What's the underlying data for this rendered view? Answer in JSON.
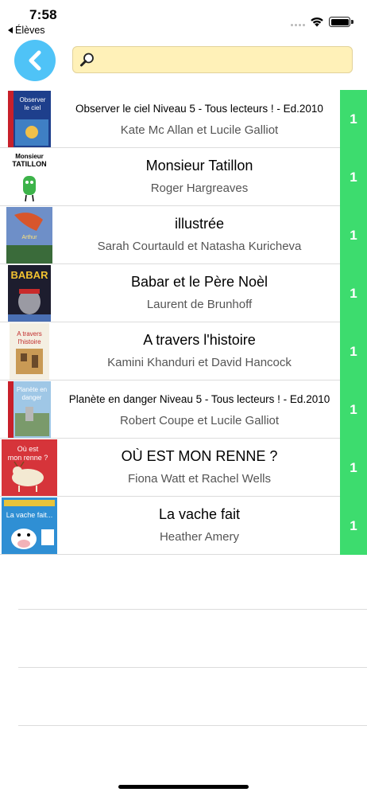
{
  "status": {
    "time": "7:58",
    "back_app_label": "Élèves"
  },
  "nav": {
    "back_icon": "chevron-left-icon",
    "search": {
      "placeholder": "",
      "value": "",
      "icon": "magnifier-icon"
    }
  },
  "colors": {
    "back_button": "#4fc3f7",
    "search_bg": "#fff1b8",
    "count_bg": "#3ddc6e"
  },
  "books": [
    {
      "title": "Observer le ciel Niveau 5 - Tous lecteurs ! - Ed.2010",
      "author": "Kate Mc Allan et Lucile Galliot",
      "count": "1",
      "cover_text": "Observer le ciel"
    },
    {
      "title": "Monsieur Tatillon",
      "author": "Roger Hargreaves",
      "count": "1",
      "cover_text": "Monsieur TATILLON"
    },
    {
      "title": "illustrée",
      "author": "Sarah Courtauld et Natasha Kuricheva",
      "count": "1",
      "cover_text": "La légende du roi Arthur illustrée"
    },
    {
      "title": "Babar et le Père Noèl",
      "author": "Laurent de Brunhoff",
      "count": "1",
      "cover_text": "BABAR"
    },
    {
      "title": "A travers l'histoire",
      "author": "Kamini Khanduri et David Hancock",
      "count": "1",
      "cover_text": "À travers l'histoire"
    },
    {
      "title": "Planète en danger Niveau 5 - Tous lecteurs ! - Ed.2010",
      "author": "Robert Coupe et Lucile Galliot",
      "count": "1",
      "cover_text": "Planète en danger"
    },
    {
      "title": "OÙ EST MON RENNE ?",
      "author": "Fiona Watt et Rachel Wells",
      "count": "1",
      "cover_text": "Où est mon renne ?"
    },
    {
      "title": "La vache fait",
      "author": "Heather Amery",
      "count": "1",
      "cover_text": "La vache fait..."
    }
  ]
}
